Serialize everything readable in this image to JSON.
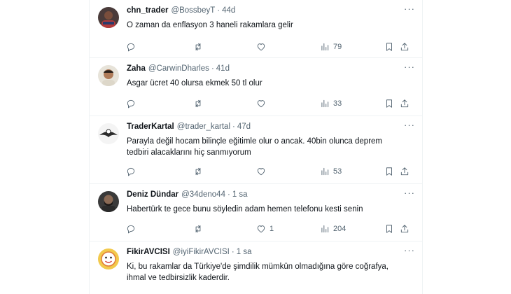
{
  "tweets": [
    {
      "display_name": "chn_trader",
      "handle": "@BossbeyT",
      "time": "44d",
      "text": "O zaman da enflasyon 3 haneli rakamlara gelir",
      "views": "79"
    },
    {
      "display_name": "Zaha",
      "handle": "@CarwinDharles",
      "time": "41d",
      "text": "Asgar ücret 40 olursa ekmek 50 tl olur",
      "views": "33"
    },
    {
      "display_name": "TraderKartal",
      "handle": "@trader_kartal",
      "time": "47d",
      "text": "Parayla değil hocam bilinçle eğitimle olur o ancak. 40bin olunca deprem tedbiri alacaklarını hiç sanmıyorum",
      "views": "53"
    },
    {
      "display_name": "Deniz Dündar",
      "handle": "@34deno44",
      "time": "1 sa",
      "text": "Habertürk te gece bunu söyledin adam hemen telefonu kesti senin",
      "likes": "1",
      "views": "204"
    },
    {
      "display_name": "FikirAVCISI",
      "handle": "@iyiFikirAVCISI",
      "time": "1 sa",
      "text": "Ki, bu rakamlar da Türkiye'de şimdilik mümkün olmadığına göre coğrafya, ihmal ve tedbirsizlik kaderdir."
    }
  ],
  "separator": "·",
  "icons": {
    "reply": "reply-icon",
    "retweet": "retweet-icon",
    "like": "heart-icon",
    "views": "views-chart-icon",
    "bookmark": "bookmark-icon",
    "share": "share-icon",
    "more": "more-dots-icon"
  },
  "colors": {
    "text": "#0f1419",
    "muted": "#536471",
    "divider": "#eff3f4"
  }
}
